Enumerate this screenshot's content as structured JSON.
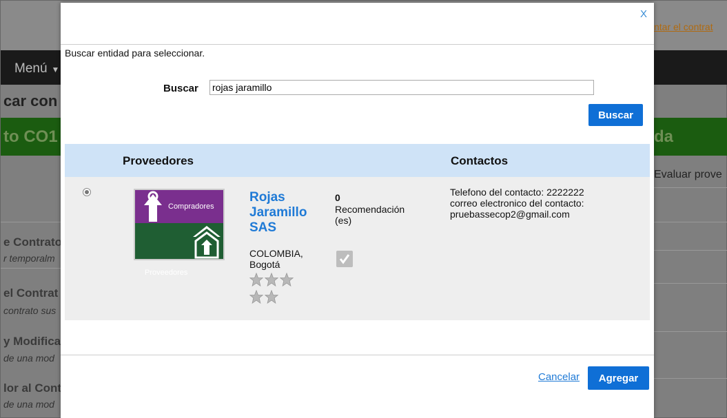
{
  "background": {
    "menu_label": "Menú",
    "page_title_fragment": "car con",
    "green_left_fragment": "to CO1",
    "green_right_fragment": "da",
    "evaluar_fragment": "Evaluar prove",
    "top_link_fragment": "ntar el contrat",
    "sections": [
      {
        "title": "e Contrato",
        "subtitle": "r temporalm"
      },
      {
        "title": "el Contrat",
        "subtitle": "contrato sus"
      },
      {
        "title": "y Modifica",
        "subtitle": "de una mod"
      },
      {
        "title": "lor al Cont",
        "subtitle": "de una mod"
      }
    ]
  },
  "modal": {
    "close_label": "X",
    "instruction": "Buscar entidad para seleccionar.",
    "search": {
      "label": "Buscar",
      "value": "rojas jaramillo"
    },
    "search_button": "Buscar",
    "table": {
      "headers": {
        "providers": "Proveedores",
        "contacts": "Contactos"
      },
      "rows": [
        {
          "logo_top_text": "Compradores",
          "logo_bottom_text": "Proveedores",
          "name": "Rojas Jaramillo SAS",
          "location": "COLOMBIA, Bogotá",
          "rating_stars": 5,
          "recommendations_count": "0",
          "recommendations_label": "Recomendación (es)",
          "contact_phone": "Telefono del contacto: 2222222",
          "contact_email": "correo electronico del contacto: pruebassecop2@gmail.com"
        }
      ]
    },
    "cancel_label": "Cancelar",
    "add_button": "Agregar"
  },
  "colors": {
    "accent": "#0f6fd6",
    "link": "#1f7ad6",
    "table_header": "#cfe3f7",
    "row_bg": "#eeeeee",
    "logo_purple": "#7a2f8e",
    "logo_green": "#1f5e33"
  }
}
